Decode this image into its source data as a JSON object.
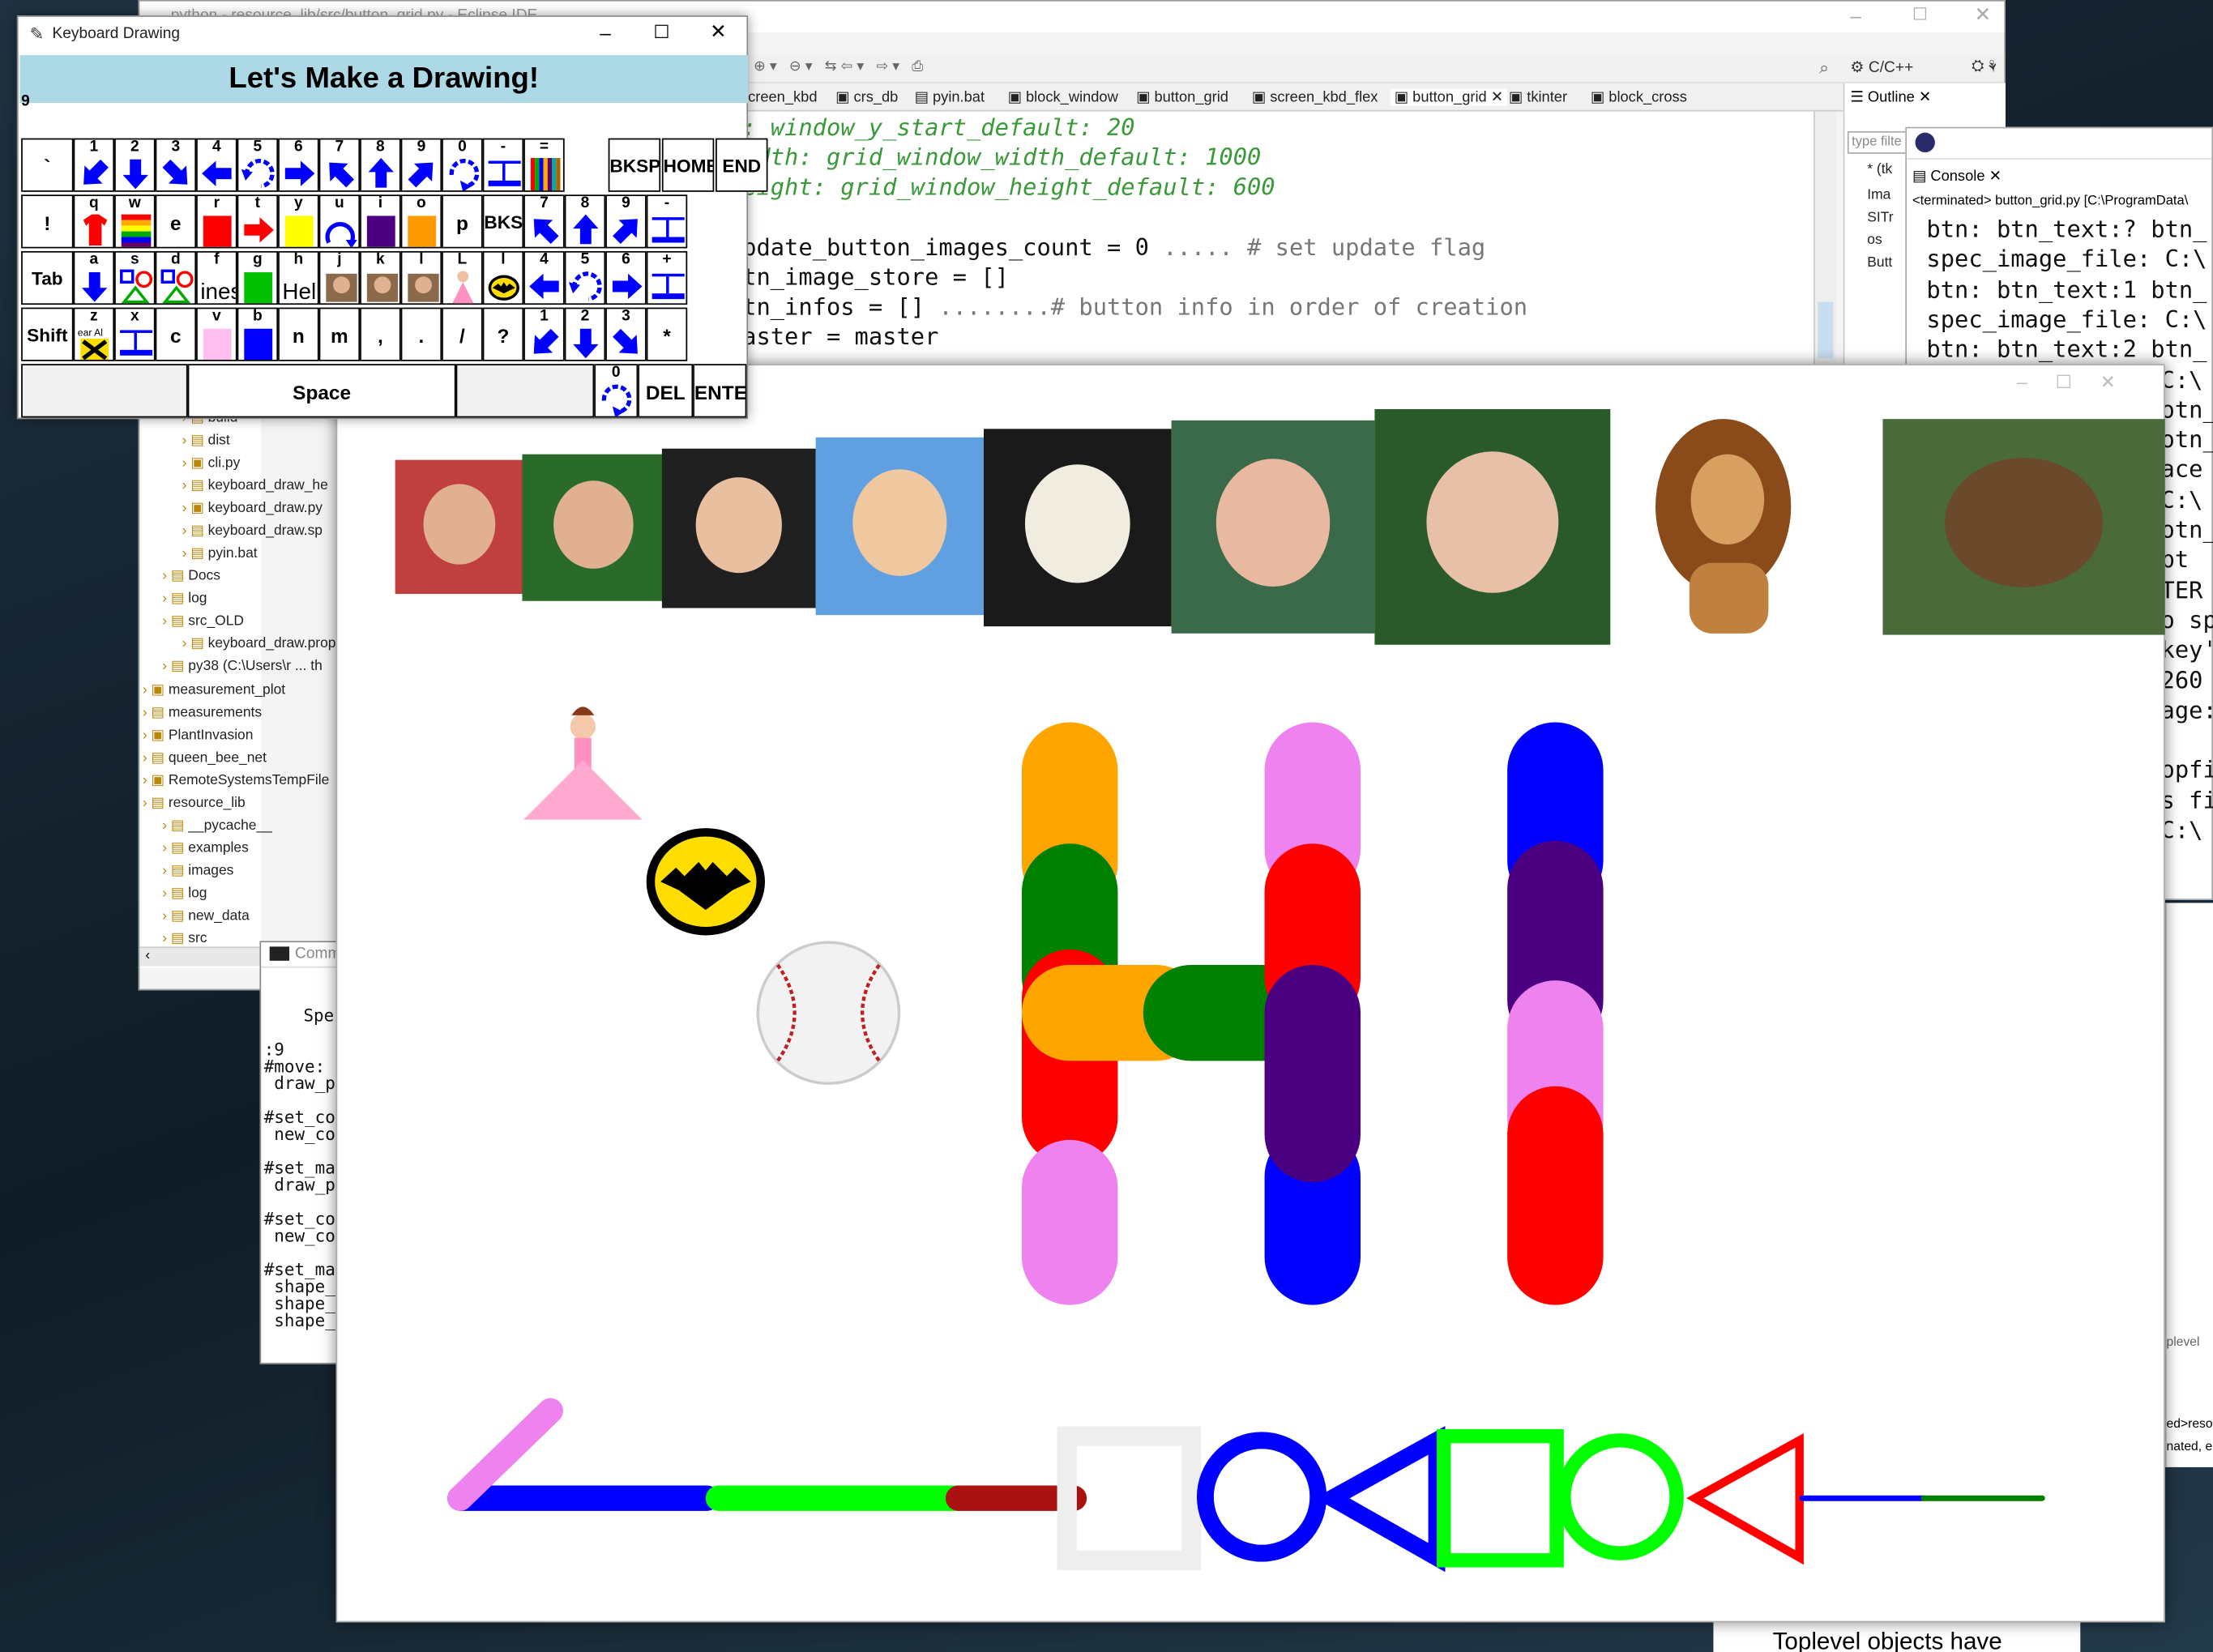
{
  "eclipse": {
    "title": "python - resource_lib/src/button_grid.py - Eclipse IDE",
    "perspective": "C/C++",
    "tabs": [
      "creen_kbd",
      "crs_db",
      "pyin.bat",
      "block_window",
      "button_grid",
      "screen_kbd_flex",
      "button_grid",
      "tkinter",
      "block_cross"
    ],
    "code": [
      {
        "a": ": window_y_start_default: 20",
        "b": ""
      },
      {
        "a": "idth: grid_window_width_default: 1000",
        "b": ""
      },
      {
        "a": "eight: grid_window_height_default: 600",
        "b": ""
      },
      {
        "a": "",
        "b": ""
      },
      {
        "a": "pdate_button_images_count = 0",
        "b": "# set update flag"
      },
      {
        "a": "tn_image_store = []",
        "b": ""
      },
      {
        "a": "tn_infos = []",
        "b": "# button info in order of creation"
      },
      {
        "a": "aster = master",
        "b": ""
      }
    ],
    "outline_label": "Outline",
    "outline_filter": "type filte",
    "outline_items": [
      "* (tk",
      "Ima",
      "SITr",
      "os",
      "Butt"
    ],
    "tree": [
      "build",
      "dist",
      "cli.py",
      "keyboard_draw_he",
      "keyboard_draw.py",
      "keyboard_draw.sp",
      "pyin.bat",
      "Docs",
      "log",
      "src_OLD",
      "keyboard_draw.prope",
      "py38  (C:\\Users\\r ... th",
      "measurement_plot",
      "measurements",
      "PlantInvasion",
      "queen_bee_net",
      "RemoteSystemsTempFile",
      "resource_lib",
      "__pycache__",
      "examples",
      "images",
      "log",
      "new_data",
      "src"
    ]
  },
  "console": {
    "tab": "Console",
    "header": "<terminated> button_grid.py [C:\\ProgramData\\",
    "lines": [
      "btn: btn_text:? btn_",
      "spec_image_file: C:\\",
      "btn: btn_text:1 btn_",
      "spec_image_file: C:\\",
      "btn: btn_text:2 btn_",
      "C:\\",
      "otn_",
      "otn_",
      "ace",
      "C:\\",
      "otn_",
      "bt",
      "TER",
      "o sp",
      "key'",
      "260",
      "age:",
      "",
      "opfi",
      "s fi",
      "C:\\"
    ],
    "lower_tab": "plevel",
    "lower_lines": [
      "ed>reso",
      "nated, e"
    ],
    "bottom_text": "Toplevel objects have"
  },
  "cmd": {
    "title": "Comm",
    "lines": [
      "",
      "Spe",
      "",
      ":9",
      "#move:",
      " draw_p",
      "",
      "#set_co",
      " new_co",
      "",
      "#set_ma",
      " draw_p",
      "",
      "#set_co",
      " new_co",
      "",
      "#set_ma",
      " shape_",
      " shape_",
      " shape_"
    ]
  },
  "keyboard": {
    "title": "Keyboard Drawing",
    "banner": "Let's Make a Drawing!",
    "entry": "9",
    "rows": [
      [
        {
          "t": "`"
        },
        {
          "t": "1",
          "ic": "arrow-down-left"
        },
        {
          "t": "2",
          "ic": "arrow-down"
        },
        {
          "t": "3",
          "ic": "arrow-down-right"
        },
        {
          "t": "4",
          "ic": "arrow-left"
        },
        {
          "t": "5",
          "ic": "rotate-ccw"
        },
        {
          "t": "6",
          "ic": "arrow-right"
        },
        {
          "t": "7",
          "ic": "arrow-up-left"
        },
        {
          "t": "8",
          "ic": "arrow-up"
        },
        {
          "t": "9",
          "ic": "arrow-up-right"
        },
        {
          "t": "0",
          "ic": "rotate-cw"
        },
        {
          "t": "-",
          "ic": "line-width"
        },
        {
          "t": "=",
          "ic": "color-bars"
        },
        {
          "t": "BKSP",
          "w": 1
        },
        {
          "t": "HOME",
          "w": 1
        },
        {
          "t": "END",
          "w": 1
        }
      ],
      [
        {
          "t": "!"
        },
        {
          "t": "q",
          "ic": "shirt"
        },
        {
          "t": "w",
          "ic": "stripes"
        },
        {
          "t": "e"
        },
        {
          "t": "r",
          "sw": "#ff0000"
        },
        {
          "t": "t",
          "ic": "red-arrow"
        },
        {
          "t": "y",
          "sw": "#ffff00"
        },
        {
          "t": "u",
          "ic": "arc"
        },
        {
          "t": "i",
          "sw": "#4b0082"
        },
        {
          "t": "o",
          "sw": "#ff9900"
        },
        {
          "t": "p"
        },
        {
          "t": "BKSP"
        },
        {
          "t": "7",
          "ic": "arrow-up-left"
        },
        {
          "t": "8",
          "ic": "arrow-up"
        },
        {
          "t": "9",
          "ic": "arrow-up-right"
        },
        {
          "t": "-",
          "ic": "line-width"
        }
      ],
      [
        {
          "t": "Tab"
        },
        {
          "t": "a",
          "ic": "arrow-down"
        },
        {
          "t": "s",
          "ic": "shapes"
        },
        {
          "t": "d",
          "ic": "shapes"
        },
        {
          "t": "f",
          "ic": "lines"
        },
        {
          "t": "g",
          "sw": "#00c000"
        },
        {
          "t": "h",
          "ic": "help"
        },
        {
          "t": "j",
          "ic": "photo"
        },
        {
          "t": "k",
          "ic": "photo"
        },
        {
          "t": "l",
          "ic": "photo"
        },
        {
          "t": "L",
          "ic": "princess"
        },
        {
          "t": "l",
          "ic": "bat"
        },
        {
          "t": "4",
          "ic": "arrow-left"
        },
        {
          "t": "5",
          "ic": "rotate-ccw"
        },
        {
          "t": "6",
          "ic": "arrow-right"
        },
        {
          "t": "+",
          "ic": "line-width"
        }
      ],
      [
        {
          "t": "Shift"
        },
        {
          "t": "z",
          "ic": "clear"
        },
        {
          "t": "x",
          "ic": "line-width"
        },
        {
          "t": "c"
        },
        {
          "t": "v",
          "sw": "#ffc0f0"
        },
        {
          "t": "b",
          "sw": "#0000ff"
        },
        {
          "t": "n"
        },
        {
          "t": "m"
        },
        {
          "t": ","
        },
        {
          "t": "."
        },
        {
          "t": "/"
        },
        {
          "t": "?"
        },
        {
          "t": "1",
          "ic": "arrow-down-left"
        },
        {
          "t": "2",
          "ic": "arrow-down"
        },
        {
          "t": "3",
          "ic": "arrow-down-right"
        },
        {
          "t": "*"
        }
      ]
    ],
    "space": "Space",
    "bottom_keys": [
      "0",
      "DEL",
      "ENTER"
    ],
    "help_label": "Help",
    "clear_label": "ear Al",
    "lines_label": "ines"
  },
  "canvas": {
    "colors": {
      "orange": "#ffa500",
      "green": "#008000",
      "red": "#ff0000",
      "violet": "#ee82ee",
      "blue": "#0000ff",
      "indigo": "#4b0082",
      "lime": "#00ff00",
      "darkred": "#aa1111"
    }
  }
}
